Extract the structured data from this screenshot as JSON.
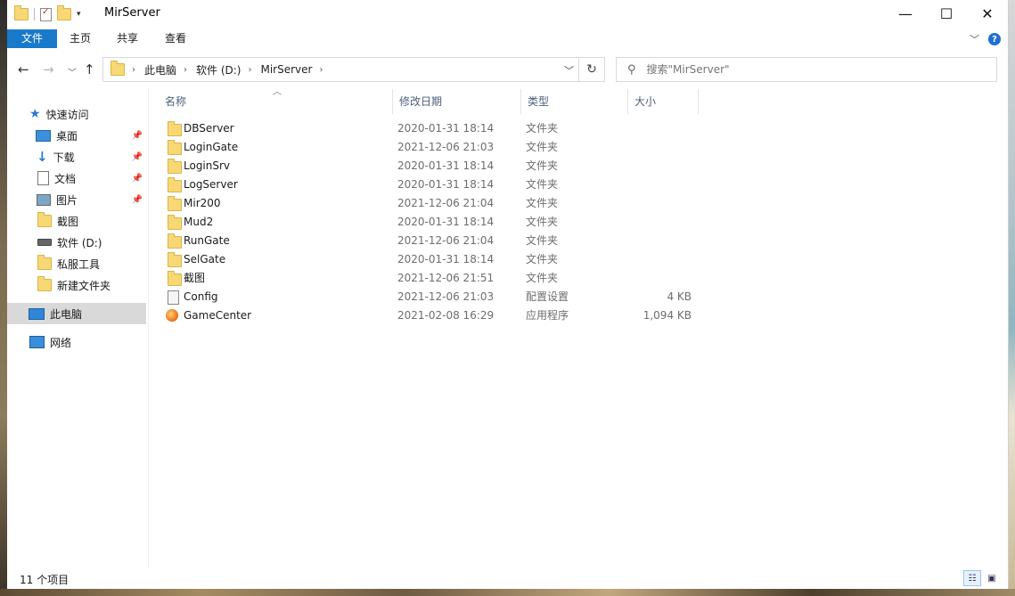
{
  "window": {
    "title": "MirServer",
    "controls": {
      "minimize": "—",
      "maximize": "☐",
      "close": "✕"
    }
  },
  "ribbon": {
    "tabs": [
      "文件",
      "主页",
      "共享",
      "查看"
    ],
    "help": "?"
  },
  "address": {
    "breadcrumbs": [
      "此电脑",
      "软件 (D:)",
      "MirServer"
    ],
    "refresh": "↻"
  },
  "search": {
    "placeholder": "搜索\"MirServer\""
  },
  "nav": {
    "quick_access": "快速访问",
    "items": [
      {
        "label": "桌面",
        "icon": "desktop-icon",
        "pinned": true
      },
      {
        "label": "下载",
        "icon": "download-icon",
        "pinned": true
      },
      {
        "label": "文档",
        "icon": "document-icon",
        "pinned": true
      },
      {
        "label": "图片",
        "icon": "pictures-icon",
        "pinned": true
      },
      {
        "label": "截图",
        "icon": "folder-icon",
        "pinned": false
      },
      {
        "label": "软件 (D:)",
        "icon": "drive-icon",
        "pinned": false
      },
      {
        "label": "私服工具",
        "icon": "folder-icon",
        "pinned": false
      },
      {
        "label": "新建文件夹",
        "icon": "folder-icon",
        "pinned": false
      }
    ],
    "this_pc": "此电脑",
    "network": "网络"
  },
  "columns": {
    "name": "名称",
    "date": "修改日期",
    "type": "类型",
    "size": "大小"
  },
  "files": [
    {
      "name": "DBServer",
      "date": "2020-01-31 18:14",
      "type": "文件夹",
      "size": "",
      "icon": "folder-icon"
    },
    {
      "name": "LoginGate",
      "date": "2021-12-06 21:03",
      "type": "文件夹",
      "size": "",
      "icon": "folder-icon"
    },
    {
      "name": "LoginSrv",
      "date": "2020-01-31 18:14",
      "type": "文件夹",
      "size": "",
      "icon": "folder-icon"
    },
    {
      "name": "LogServer",
      "date": "2020-01-31 18:14",
      "type": "文件夹",
      "size": "",
      "icon": "folder-icon"
    },
    {
      "name": "Mir200",
      "date": "2021-12-06 21:04",
      "type": "文件夹",
      "size": "",
      "icon": "folder-icon"
    },
    {
      "name": "Mud2",
      "date": "2020-01-31 18:14",
      "type": "文件夹",
      "size": "",
      "icon": "folder-icon"
    },
    {
      "name": "RunGate",
      "date": "2021-12-06 21:04",
      "type": "文件夹",
      "size": "",
      "icon": "folder-icon"
    },
    {
      "name": "SelGate",
      "date": "2020-01-31 18:14",
      "type": "文件夹",
      "size": "",
      "icon": "folder-icon"
    },
    {
      "name": "截图",
      "date": "2021-12-06 21:51",
      "type": "文件夹",
      "size": "",
      "icon": "folder-icon"
    },
    {
      "name": "Config",
      "date": "2021-12-06 21:03",
      "type": "配置设置",
      "size": "4 KB",
      "icon": "config-file-icon"
    },
    {
      "name": "GameCenter",
      "date": "2021-02-08 16:29",
      "type": "应用程序",
      "size": "1,094 KB",
      "icon": "application-icon"
    }
  ],
  "status": {
    "item_count": "11 个项目"
  },
  "colors": {
    "accent": "#1979ca",
    "selected_nav": "#d9d9d9",
    "folder": "#f8d775"
  }
}
